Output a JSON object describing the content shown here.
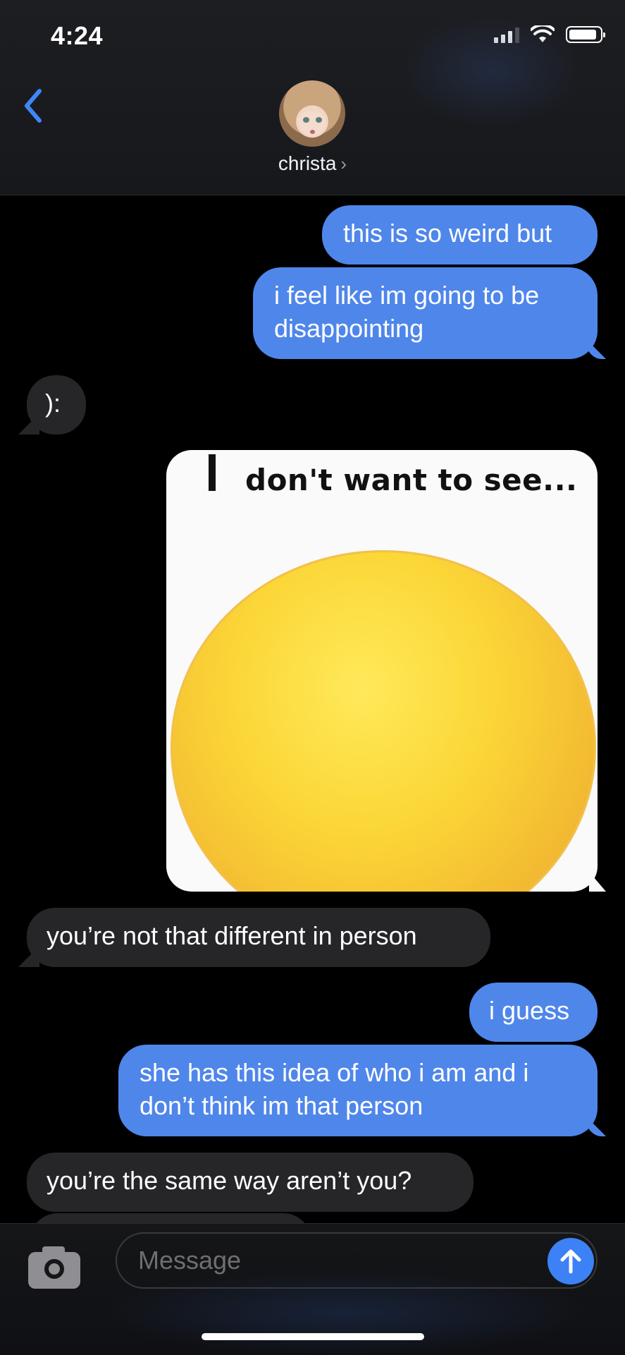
{
  "status_bar": {
    "time": "4:24"
  },
  "header": {
    "contact_name": "christa",
    "chevron": "›"
  },
  "messages": [
    {
      "dir": "out",
      "text": "this is so weird but"
    },
    {
      "dir": "out",
      "text": "i feel like im going to be disappointing"
    },
    {
      "dir": "in",
      "text": "):"
    },
    {
      "dir": "out",
      "type": "image",
      "caption_text": "don't want to see..."
    },
    {
      "dir": "in",
      "text": "you’re not that different in person"
    },
    {
      "dir": "out",
      "text": "i guess"
    },
    {
      "dir": "out",
      "text": "she has this idea of who i am and i don’t think im that person"
    },
    {
      "dir": "in",
      "text": "you’re the same way aren’t you?"
    }
  ],
  "composer": {
    "placeholder": "Message"
  },
  "icons": [
    "back-chevron-icon",
    "signal-icon",
    "wifi-icon",
    "battery-icon",
    "camera-icon",
    "send-arrow-icon"
  ],
  "colors": {
    "outgoing": "#4f86ea",
    "incoming": "#262629",
    "accent": "#3c82f6"
  }
}
